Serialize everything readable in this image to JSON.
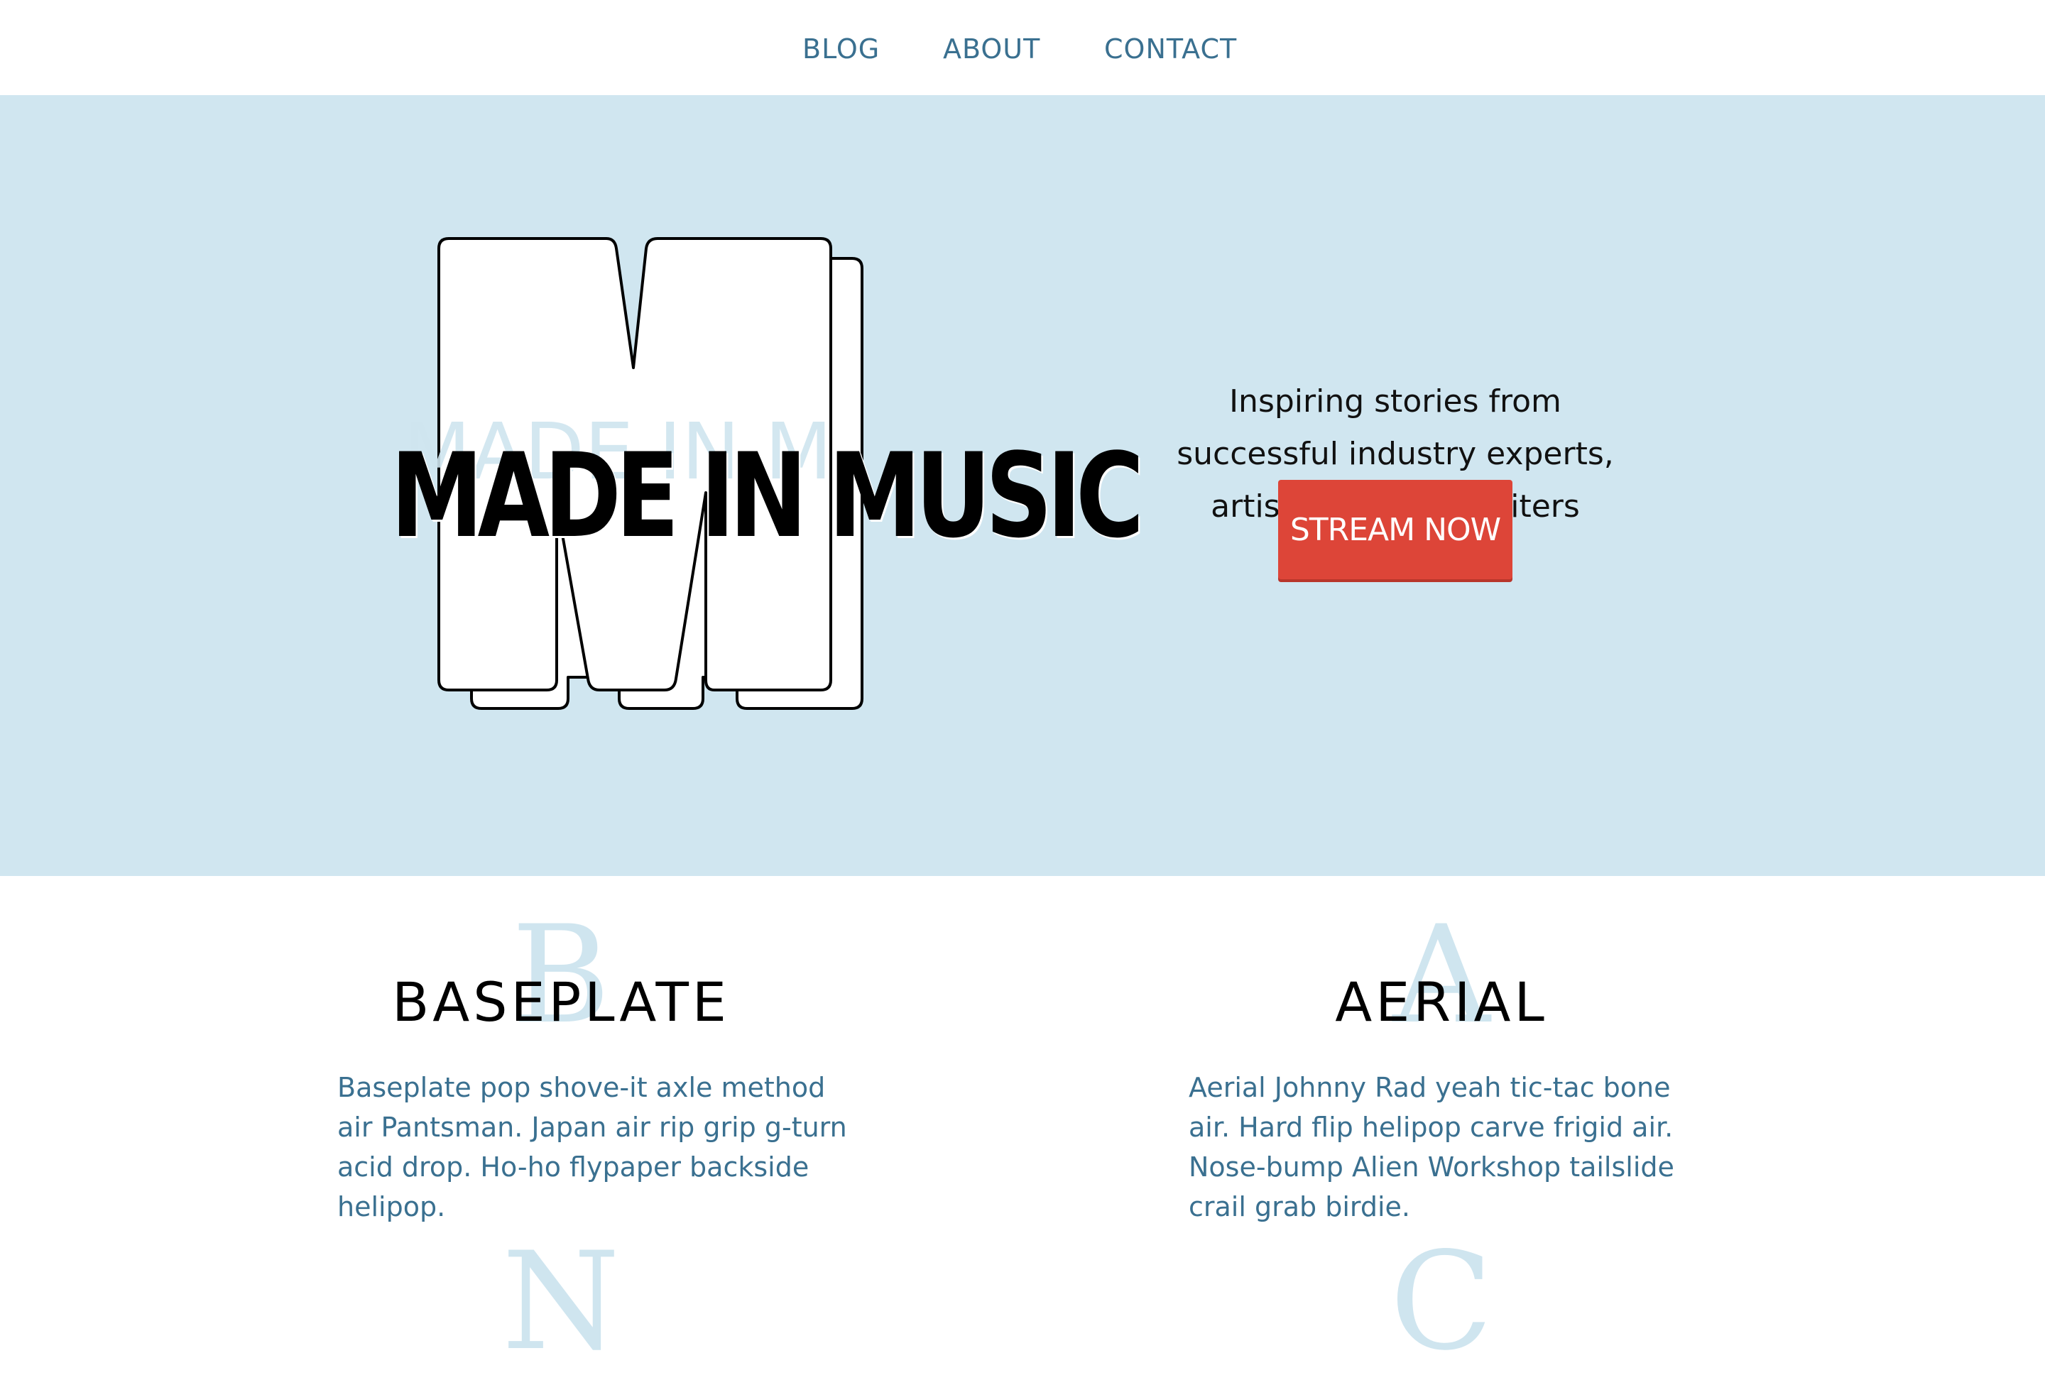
{
  "nav": {
    "items": [
      {
        "label": "BLOG"
      },
      {
        "label": "ABOUT"
      },
      {
        "label": "CONTACT"
      }
    ]
  },
  "hero": {
    "title": "MADE IN MUSIC",
    "logo_letter_icon": "outlined-m-logo",
    "tagline": [
      "Inspiring stories from",
      "successful industry experts,",
      "artists, and songwriters"
    ],
    "cta_label": "STREAM NOW"
  },
  "features": [
    {
      "initial": "B",
      "initial_bottom": "N",
      "title": "BASEPLATE",
      "body": "Baseplate pop shove-it axle method air Pantsman. Japan air rip grip g-turn acid drop. Ho-ho flypaper backside helipop."
    },
    {
      "initial": "A",
      "initial_bottom": "C",
      "title": "AERIAL",
      "body": "Aerial Johnny Rad yeah tic-tac bone air. Hard flip helipop carve frigid air. Nose-bump Alien Workshop tailslide crail grab birdie."
    }
  ],
  "colors": {
    "hero_background": "#d0e6f0",
    "nav_text": "#3a7090",
    "cta_background": "#dd4538",
    "initial_letter": "#cfe5ef"
  }
}
